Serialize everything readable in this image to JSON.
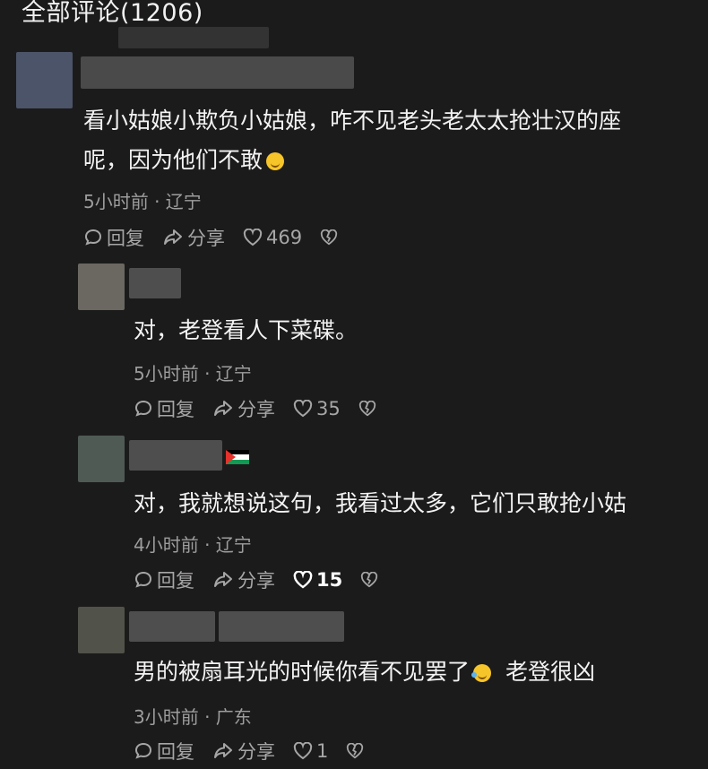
{
  "header": {
    "title": "全部评论(1206)"
  },
  "comments": [
    {
      "text_line1": "看小姑娘小欺负小姑娘，咋不见老头老太太抢壮汉的座",
      "text_line2": "呢，因为他们不敢",
      "emoji": "smirk-emoji",
      "meta": "5小时前 · 辽宁",
      "reply": "回复",
      "share": "分享",
      "likes": "469",
      "liked": false
    },
    {
      "text_line1": "对，老登看人下菜碟。",
      "meta": "5小时前 · 辽宁",
      "reply": "回复",
      "share": "分享",
      "likes": "35",
      "liked": false
    },
    {
      "text_line1": "对，我就想说这句，我看过太多，它们只敢抢小姑",
      "flag": "palestine-flag-icon",
      "meta": "4小时前 · 辽宁",
      "reply": "回复",
      "share": "分享",
      "likes": "15",
      "liked": true
    },
    {
      "text_line1": "男的被扇耳光的时候你看不见罢了",
      "text_line1b": "老登很凶",
      "emoji": "laughing-crying-emoji",
      "meta": "3小时前 · 广东",
      "reply": "回复",
      "share": "分享",
      "likes": "1",
      "liked": false
    }
  ],
  "colors": {
    "background": "#1c1b1b",
    "text": "#f3f3f3",
    "meta": "#9d9d9d"
  }
}
